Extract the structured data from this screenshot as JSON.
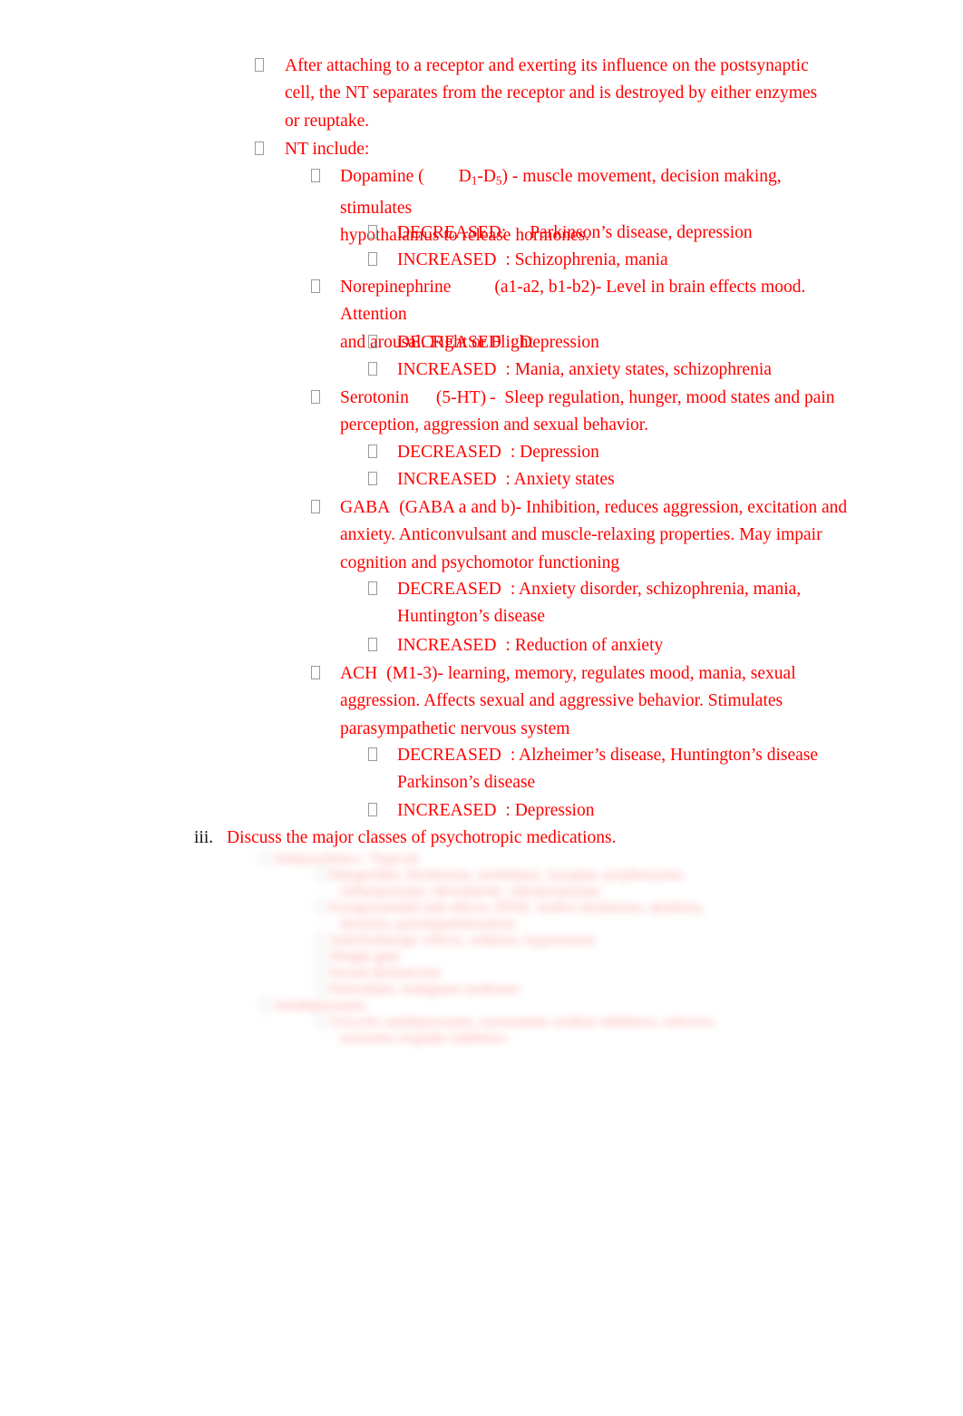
{
  "document": {
    "text_color": "#FF0000",
    "marker_color": "#111111",
    "bullet_glyph": "tofu-box",
    "background": "#FFFFFF"
  },
  "outline": {
    "items": [
      {
        "level": 1,
        "bullet": "tofu-bullet",
        "lines": [
          "After attaching to a receptor and exerting its influence on the postsynaptic",
          "cell, the NT separates from the receptor and is destroyed by either enzymes",
          "or reuptake."
        ]
      },
      {
        "level": 1,
        "bullet": "tofu-bullet",
        "lines": [
          "NT include:"
        ]
      }
    ]
  },
  "neurotransmitters": [
    {
      "name": "Dopamine",
      "receptor_open": "Dopamine (",
      "receptor_code": "D1-D5",
      "receptor_sub_1": "1",
      "receptor_sub_2": "5",
      "line1_tail": ") - muscle movement, decision making, stimulates",
      "line2": "hypothalamus to release hormones.",
      "effects": [
        {
          "label": "DECREASED:",
          "values": "Parkinson’s disease, depression"
        },
        {
          "label": "INCREASED",
          "values": ": Schizophrenia, mania"
        }
      ]
    },
    {
      "name": "Norepinephrine",
      "receptor_code": "(a1-a2, b1-b2)",
      "line1_tail": "- Level in brain effects mood. Attention",
      "line2": "and arousal. Fight or Flight",
      "effects": [
        {
          "label": "DECREASED",
          "values": ": Depression"
        },
        {
          "label": "INCREASED",
          "values": ": Mania, anxiety states, schizophrenia"
        }
      ]
    },
    {
      "name": "Serotonin",
      "receptor_code": "(5-HT)",
      "line1_tail": "-  Sleep regulation, hunger, mood states and pain",
      "line2": "perception, aggression and sexual behavior.",
      "effects": [
        {
          "label": "DECREASED",
          "values": ": Depression"
        },
        {
          "label": "INCREASED",
          "values": ": Anxiety states"
        }
      ]
    },
    {
      "name": "GABA",
      "receptor_code": "(GABA a and b)",
      "line1_tail": "- Inhibition, reduces aggression, excitation and",
      "line2": "anxiety. Anticonvulsant and muscle-relaxing properties. May impair",
      "line3": "cognition and psychomotor functioning",
      "effects": [
        {
          "label": "DECREASED",
          "values": ": Anxiety disorder, schizophrenia, mania,",
          "cont": "Huntington’s disease"
        },
        {
          "label": "INCREASED",
          "values": ": Reduction of anxiety"
        }
      ]
    },
    {
      "name": "ACH",
      "receptor_code": "(M1-3)",
      "line1_tail": "- learning, memory, regulates mood, mania, sexual",
      "line2": "aggression. Affects sexual and aggressive behavior. Stimulates",
      "line3": "parasympathetic nervous system",
      "effects": [
        {
          "label": "DECREASED",
          "values": ": Alzheimer’s disease, Huntington’s disease",
          "cont": "Parkinson’s disease"
        },
        {
          "label": "INCREASED",
          "values": ": Depression"
        }
      ]
    }
  ],
  "section_iii": {
    "marker": "iii.",
    "text": "Discuss the major classes of psychotropic medications."
  },
  "redacted": {
    "note": "blurred-illegible-content",
    "groups": [
      {
        "heading": "Antipsychotics / Typicals",
        "items": [
          {
            "lines": [
              "Haloperidol, thiothixene, molindone, loxapine, perphenazine,",
              "trifluoperazine, thioridazine, chlorpromazine"
            ]
          },
          {
            "lines": [
              "Extrapyramidal side effects, EPSE, tardive dyskinesia, akathisia,",
              "dystonia, pseudoparkinsonism"
            ]
          },
          {
            "lines": [
              "Anticholinergic effects, sedation, hypotension"
            ]
          },
          {
            "lines": [
              "Weight gain"
            ]
          },
          {
            "lines": [
              "Sexual dysfunction"
            ]
          },
          {
            "lines": [
              "Neuroleptic malignant syndrome"
            ]
          }
        ]
      },
      {
        "heading": "Antidepressants",
        "items": [
          {
            "lines": [
              "Tricyclic antidepressants, monoamine oxidase inhibitors, selective",
              "serotonin reuptake inhibitors"
            ]
          }
        ]
      }
    ]
  }
}
